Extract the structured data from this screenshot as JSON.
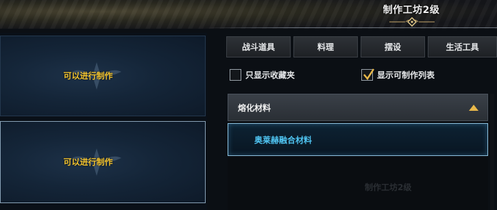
{
  "header": {
    "title": "制作工坊2级"
  },
  "slots": [
    {
      "label": "可以进行制作",
      "selected": false
    },
    {
      "label": "可以进行制作",
      "selected": true
    }
  ],
  "tabs": [
    {
      "label": "战斗道具"
    },
    {
      "label": "料理"
    },
    {
      "label": "摆设"
    },
    {
      "label": "生活工具"
    }
  ],
  "filters": {
    "favorites_only": {
      "label": "只显示收藏夹",
      "checked": false
    },
    "craftable_only": {
      "label": "显示可制作列表",
      "checked": true
    }
  },
  "category": {
    "label": "熔化材料",
    "icon": "chevron-up-icon",
    "expanded": true
  },
  "recipes": [
    {
      "label": "奥莱赫融合材料",
      "selected": true
    }
  ],
  "watermark": "制作工坊2级",
  "colors": {
    "accent_gold": "#f2c431",
    "selected_blue": "#4fc3f0",
    "chevron_gold": "#e8b84a"
  }
}
